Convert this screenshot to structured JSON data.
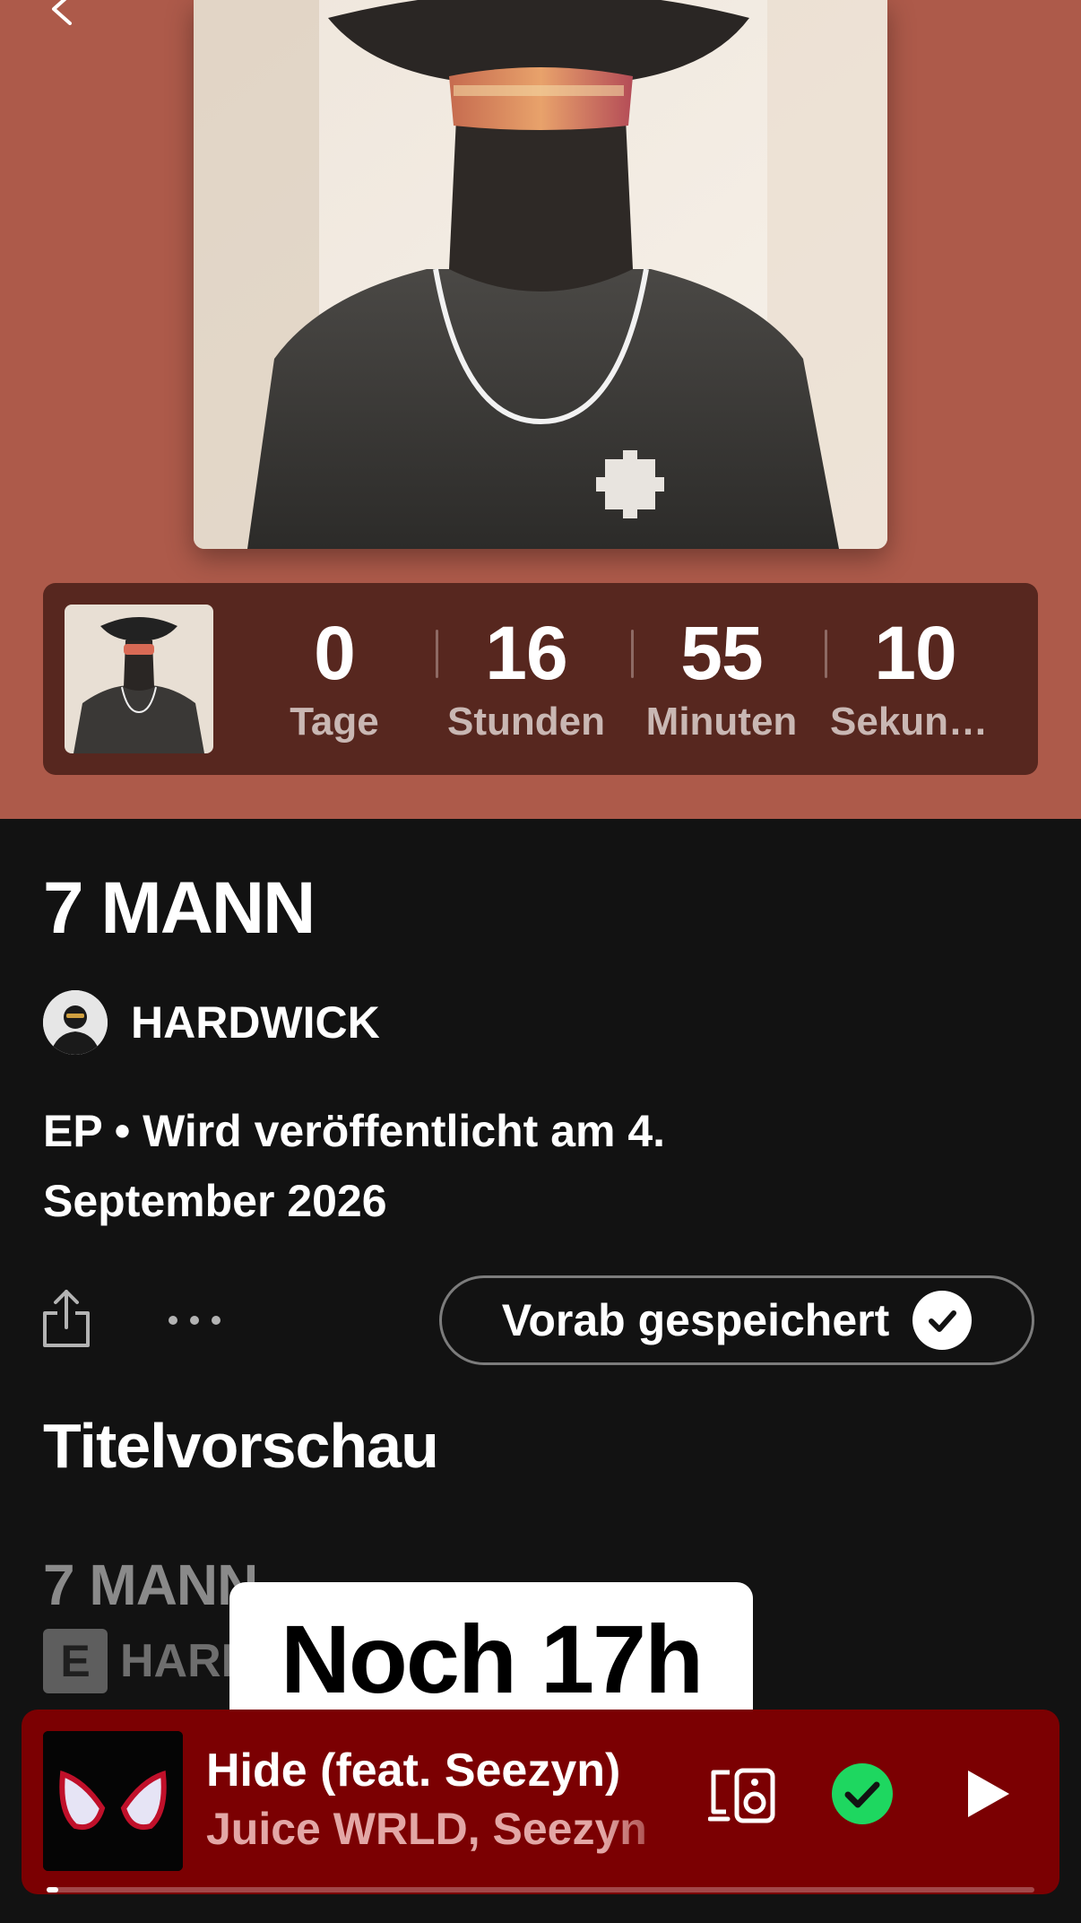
{
  "header": {
    "countdown": [
      {
        "value": "0",
        "label": "Tage"
      },
      {
        "value": "16",
        "label": "Stunden"
      },
      {
        "value": "55",
        "label": "Minuten"
      },
      {
        "value": "10",
        "label": "Sekunden"
      }
    ]
  },
  "release": {
    "title": "7 MANN",
    "artist": "HARDWICK",
    "meta_line1": "EP • Wird veröffentlicht am 4.",
    "meta_line2": "September 2026",
    "presave_label": "Vorab gespeichert"
  },
  "preview": {
    "section_title": "Titelvorschau",
    "track_title": "7 MANN",
    "explicit_badge": "E",
    "track_artist": "HARDWICK"
  },
  "overlay": {
    "text": "Noch 17h"
  },
  "player": {
    "title": "Hide (feat. Seezyn)",
    "artist": "Juice WRLD, Seezyn",
    "progress": 0.01
  },
  "colors": {
    "header_bg": "#ad5a4a",
    "countdown_bg": "#57271f",
    "player_bg": "#7b0002",
    "saved_green": "#1ed760"
  },
  "icons": [
    "back-icon",
    "share-icon",
    "more-icon",
    "check-icon",
    "device-icon",
    "saved-check-icon",
    "play-icon"
  ]
}
